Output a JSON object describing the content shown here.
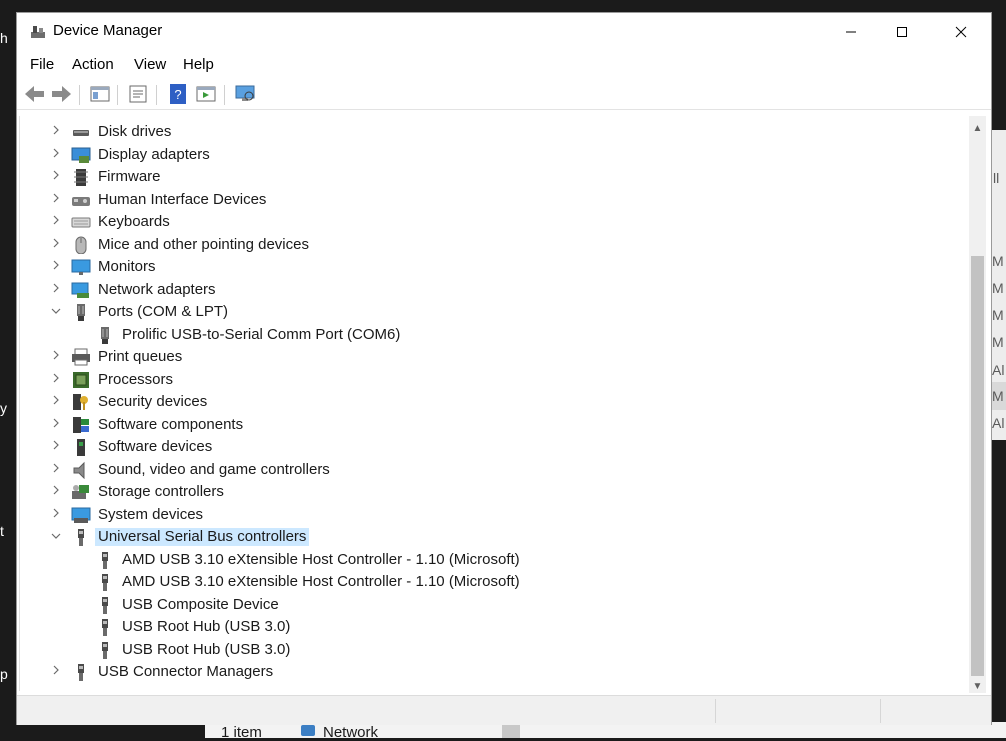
{
  "window": {
    "title": "Device Manager"
  },
  "menu": [
    "File",
    "Action",
    "View",
    "Help"
  ],
  "tree": [
    {
      "label": "Disk drives",
      "icon": "disk-drive-icon",
      "expander": ">",
      "indent": 0
    },
    {
      "label": "Display adapters",
      "icon": "display-adapter-icon",
      "expander": ">",
      "indent": 0
    },
    {
      "label": "Firmware",
      "icon": "firmware-icon",
      "expander": ">",
      "indent": 0
    },
    {
      "label": "Human Interface Devices",
      "icon": "hid-icon",
      "expander": ">",
      "indent": 0
    },
    {
      "label": "Keyboards",
      "icon": "keyboard-icon",
      "expander": ">",
      "indent": 0
    },
    {
      "label": "Mice and other pointing devices",
      "icon": "mouse-icon",
      "expander": ">",
      "indent": 0
    },
    {
      "label": "Monitors",
      "icon": "monitor-icon",
      "expander": ">",
      "indent": 0
    },
    {
      "label": "Network adapters",
      "icon": "network-adapter-icon",
      "expander": ">",
      "indent": 0
    },
    {
      "label": "Ports (COM & LPT)",
      "icon": "port-icon",
      "expander": "v",
      "indent": 0
    },
    {
      "label": "Prolific USB-to-Serial Comm Port (COM6)",
      "icon": "port-icon",
      "expander": "",
      "indent": 1
    },
    {
      "label": "Print queues",
      "icon": "printer-icon",
      "expander": ">",
      "indent": 0
    },
    {
      "label": "Processors",
      "icon": "processor-icon",
      "expander": ">",
      "indent": 0
    },
    {
      "label": "Security devices",
      "icon": "security-device-icon",
      "expander": ">",
      "indent": 0
    },
    {
      "label": "Software components",
      "icon": "software-component-icon",
      "expander": ">",
      "indent": 0
    },
    {
      "label": "Software devices",
      "icon": "software-device-icon",
      "expander": ">",
      "indent": 0
    },
    {
      "label": "Sound, video and game controllers",
      "icon": "speaker-icon",
      "expander": ">",
      "indent": 0
    },
    {
      "label": "Storage controllers",
      "icon": "storage-controller-icon",
      "expander": ">",
      "indent": 0
    },
    {
      "label": "System devices",
      "icon": "system-device-icon",
      "expander": ">",
      "indent": 0
    },
    {
      "label": "Universal Serial Bus controllers",
      "icon": "usb-icon",
      "expander": "v",
      "indent": 0,
      "selected": true
    },
    {
      "label": "AMD USB 3.10 eXtensible Host Controller - 1.10 (Microsoft)",
      "icon": "usb-icon",
      "expander": "",
      "indent": 1
    },
    {
      "label": "AMD USB 3.10 eXtensible Host Controller - 1.10 (Microsoft)",
      "icon": "usb-icon",
      "expander": "",
      "indent": 1
    },
    {
      "label": "USB Composite Device",
      "icon": "usb-icon",
      "expander": "",
      "indent": 1
    },
    {
      "label": "USB Root Hub (USB 3.0)",
      "icon": "usb-icon",
      "expander": "",
      "indent": 1
    },
    {
      "label": "USB Root Hub (USB 3.0)",
      "icon": "usb-icon",
      "expander": "",
      "indent": 1
    },
    {
      "label": "USB Connector Managers",
      "icon": "usb-icon",
      "expander": ">",
      "indent": 0
    }
  ],
  "background": {
    "edge_left": [
      "h",
      "y",
      "t",
      "p"
    ],
    "edge_right": [
      "ll",
      "M",
      "M",
      "M",
      "M",
      "Al",
      "M",
      "Al"
    ],
    "taskbar_items": "1 item",
    "taskbar_network": "Network"
  },
  "colors": {
    "selection": "#cce8ff",
    "window_bg": "#ffffff",
    "chrome_bg": "#f0f0f0"
  }
}
